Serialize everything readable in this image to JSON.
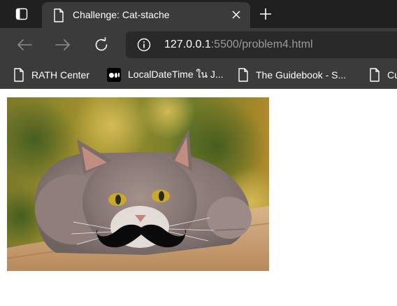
{
  "tab": {
    "title": "Challenge: Cat-stache"
  },
  "address_bar": {
    "url_host": "127.0.0.1",
    "url_path": ":5500/problem4.html"
  },
  "bookmarks": [
    {
      "label": "RATH Center",
      "icon": "document-icon"
    },
    {
      "label": "LocalDateTime ใน J...",
      "icon": "medium-icon"
    },
    {
      "label": "The Guidebook - S...",
      "icon": "document-icon"
    },
    {
      "label": "Cu",
      "icon": "document-icon"
    }
  ],
  "page": {
    "image": "cat-with-mustache-photo"
  },
  "colors": {
    "tabstrip": "#202020",
    "toolbar": "#3b3b3b",
    "omnibox": "#292929",
    "page_background": "#ffffff"
  }
}
